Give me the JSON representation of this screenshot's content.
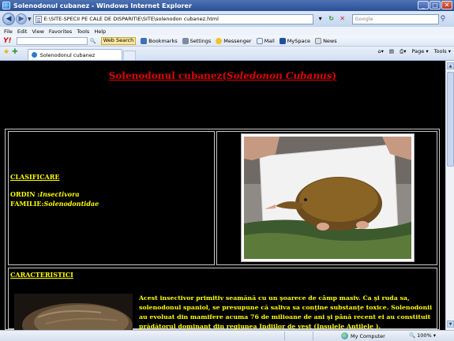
{
  "window": {
    "title": "Solenodonul cubanez - Windows Internet Explorer",
    "buttons": {
      "minimize": "_",
      "maximize": "□",
      "close": "✕"
    }
  },
  "address_bar": {
    "url": "E:\\SITE-SPECII PE CALE DE DISPARITIE\\SITE\\solenodon cubanez.html",
    "search_placeholder": "Google"
  },
  "menu": [
    "File",
    "Edit",
    "View",
    "Favorites",
    "Tools",
    "Help"
  ],
  "yahoo_toolbar": {
    "logo": "Y!",
    "web_search": "Web Search",
    "bookmarks": "Bookmarks",
    "settings": "Settings",
    "messenger": "Messenger",
    "mail": "Mail",
    "myspace": "MySpace",
    "news": "News"
  },
  "tabs": [
    {
      "label": "Solenodonul cubanez"
    }
  ],
  "command_bar": {
    "page": "Page",
    "tools": "Tools"
  },
  "page": {
    "title_common": "Solenodonul cubanez",
    "title_paren_open": "(",
    "title_latin": "Soledonon Cubanus",
    "title_paren_close": ")",
    "clasificare_heading": "CLASIFICARE",
    "ordin_label": "ORDIN :",
    "ordin_value": "Insectivora",
    "familie_label": "FAMILIE:",
    "familie_value": "Solenodontidae",
    "caracteristici_heading": "CARACTERISTICI",
    "description": "Acest  insectivor primitiv seamănă cu un şoarece de câmp masiv. Ca şi ruda sa, solenodonul spaniol, se presupune că saliva sa conţine substanţe toxice. Solenodonii au evoluat din mamifere acuma 76 de milioane de ani şi până recent ei au constituit prădătorul dominant din regiunea Indiilor de vest (Insulele Antilele )."
  },
  "status_bar": {
    "zone": "My Computer",
    "zoom": "100%"
  },
  "colors": {
    "page_background": "#000000",
    "title_red": "#e00000",
    "text_yellow": "#ffff00",
    "ie_chrome_blue": "#2a4f95"
  }
}
